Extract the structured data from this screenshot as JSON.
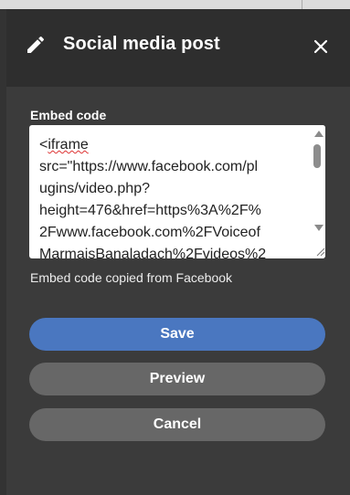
{
  "dialog": {
    "title": "Social media post",
    "icon": "pencil-icon",
    "close_icon": "close-icon"
  },
  "embed": {
    "label": "Embed code",
    "lines": [
      "<iframe",
      "src=\"https://www.facebook.com/pl",
      "ugins/video.php?",
      "height=476&href=https%3A%2F%",
      "2Fwww.facebook.com%2FVoiceof",
      "MarmaisBanaladach%2Fvideos%2"
    ],
    "help_text": "Embed code copied from Facebook"
  },
  "buttons": {
    "save": "Save",
    "preview": "Preview",
    "cancel": "Cancel"
  },
  "colors": {
    "header_bg": "#2e2e2e",
    "panel_bg": "#3b3b3b",
    "primary": "#4a77c0",
    "secondary": "#676767"
  }
}
